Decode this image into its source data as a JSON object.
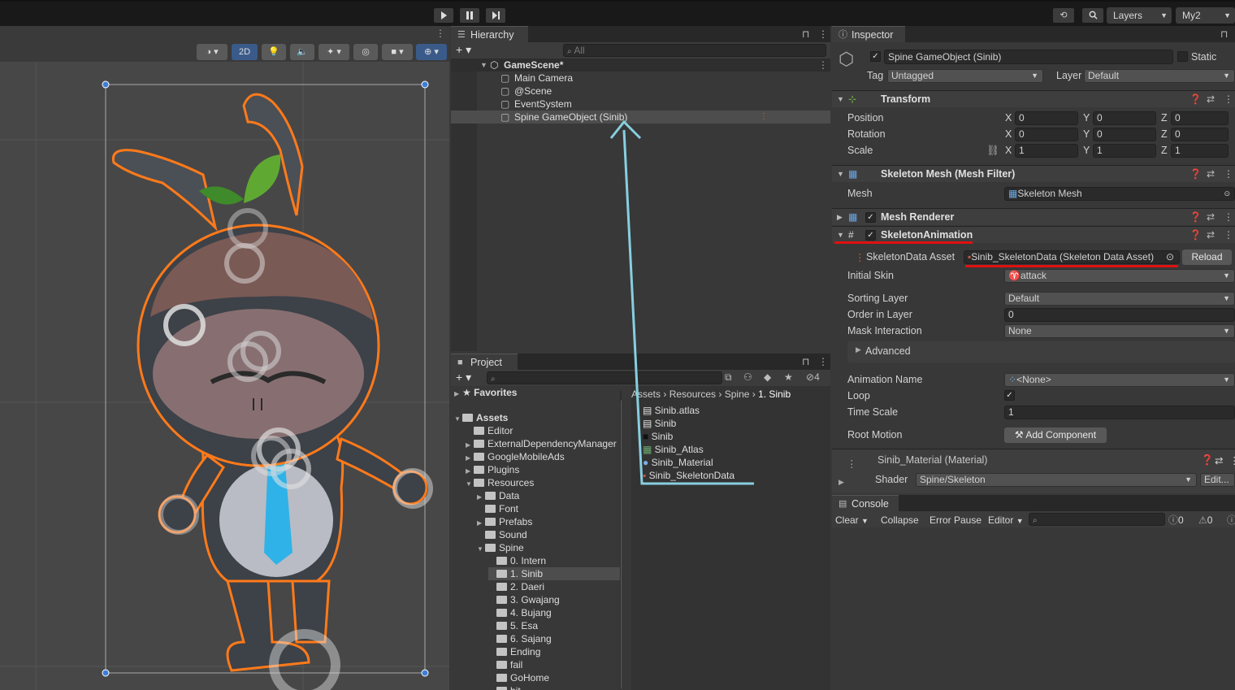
{
  "toolbar": {
    "play_icon": "play-icon",
    "pause_icon": "pause-icon",
    "step_icon": "step-icon",
    "layers_label": "Layers",
    "layout_label": "My2"
  },
  "scene": {
    "mode_2d": "2D"
  },
  "hierarchy": {
    "tab_label": "Hierarchy",
    "search_placeholder": "All",
    "scene_name": "GameScene*",
    "items": [
      {
        "label": "Main Camera"
      },
      {
        "label": "@Scene"
      },
      {
        "label": "EventSystem"
      },
      {
        "label": "Spine GameObject (Sinib)"
      }
    ]
  },
  "project": {
    "tab_label": "Project",
    "hidden_count": "4",
    "favorites_label": "Favorites",
    "assets_label": "Assets",
    "tree": [
      {
        "label": "Editor",
        "indent": 1,
        "arrow": false
      },
      {
        "label": "ExternalDependencyManager",
        "indent": 1,
        "arrow": true
      },
      {
        "label": "GoogleMobileAds",
        "indent": 1,
        "arrow": true
      },
      {
        "label": "Plugins",
        "indent": 1,
        "arrow": true
      },
      {
        "label": "Resources",
        "indent": 1,
        "arrow": true,
        "open": true
      },
      {
        "label": "Data",
        "indent": 2,
        "arrow": true
      },
      {
        "label": "Font",
        "indent": 2,
        "arrow": false
      },
      {
        "label": "Prefabs",
        "indent": 2,
        "arrow": true
      },
      {
        "label": "Sound",
        "indent": 2,
        "arrow": false
      },
      {
        "label": "Spine",
        "indent": 2,
        "arrow": true,
        "open": true
      },
      {
        "label": "0. Intern",
        "indent": 3,
        "arrow": false
      },
      {
        "label": "1. Sinib",
        "indent": 3,
        "arrow": false,
        "selected": true
      },
      {
        "label": "2. Daeri",
        "indent": 3,
        "arrow": false
      },
      {
        "label": "3. Gwajang",
        "indent": 3,
        "arrow": false
      },
      {
        "label": "4. Bujang",
        "indent": 3,
        "arrow": false
      },
      {
        "label": "5. Esa",
        "indent": 3,
        "arrow": false
      },
      {
        "label": "6. Sajang",
        "indent": 3,
        "arrow": false
      },
      {
        "label": "Ending",
        "indent": 3,
        "arrow": false
      },
      {
        "label": "fail",
        "indent": 3,
        "arrow": false
      },
      {
        "label": "GoHome",
        "indent": 3,
        "arrow": false
      },
      {
        "label": "hit",
        "indent": 3,
        "arrow": false
      }
    ],
    "breadcrumb": [
      "Assets",
      "Resources",
      "Spine",
      "1. Sinib"
    ],
    "files": [
      {
        "label": "Sinib.atlas",
        "icon": "text-file-icon"
      },
      {
        "label": "Sinib",
        "icon": "text-file-icon"
      },
      {
        "label": "Sinib",
        "icon": "texture-icon"
      },
      {
        "label": "Sinib_Atlas",
        "icon": "atlas-asset-icon"
      },
      {
        "label": "Sinib_Material",
        "icon": "material-icon"
      },
      {
        "label": "Sinib_SkeletonData",
        "icon": "skeleton-data-icon"
      }
    ]
  },
  "inspector": {
    "tab_label": "Inspector",
    "object_name": "Spine GameObject (Sinib)",
    "static_label": "Static",
    "tag_label": "Tag",
    "tag_value": "Untagged",
    "layer_label": "Layer",
    "layer_value": "Default",
    "transform": {
      "title": "Transform",
      "position_label": "Position",
      "rotation_label": "Rotation",
      "scale_label": "Scale",
      "position": {
        "x": "0",
        "y": "0",
        "z": "0"
      },
      "rotation": {
        "x": "0",
        "y": "0",
        "z": "0"
      },
      "scale": {
        "x": "1",
        "y": "1",
        "z": "1"
      }
    },
    "mesh_filter": {
      "title": "Skeleton Mesh (Mesh Filter)",
      "mesh_label": "Mesh",
      "mesh_value": "Skeleton Mesh"
    },
    "mesh_renderer": {
      "title": "Mesh Renderer"
    },
    "skeleton_animation": {
      "title": "SkeletonAnimation",
      "data_asset_label": "SkeletonData Asset",
      "data_asset_value": "Sinib_SkeletonData (Skeleton Data Asset)",
      "reload_label": "Reload",
      "initial_skin_label": "Initial Skin",
      "initial_skin_value": "attack",
      "sorting_layer_label": "Sorting Layer",
      "sorting_layer_value": "Default",
      "order_label": "Order in Layer",
      "order_value": "0",
      "mask_label": "Mask Interaction",
      "mask_value": "None",
      "advanced_label": "Advanced",
      "anim_name_label": "Animation Name",
      "anim_name_value": "<None>",
      "loop_label": "Loop",
      "time_scale_label": "Time Scale",
      "time_scale_value": "1",
      "root_motion_label": "Root Motion",
      "add_component_label": "Add Component"
    },
    "material": {
      "title": "Sinib_Material (Material)",
      "shader_label": "Shader",
      "shader_value": "Spine/Skeleton",
      "edit_label": "Edit..."
    }
  },
  "console": {
    "tab_label": "Console",
    "clear_label": "Clear",
    "collapse_label": "Collapse",
    "error_pause_label": "Error Pause",
    "editor_label": "Editor",
    "info_count": "0",
    "warn_count": "0"
  },
  "annotation": {
    "drag_arrow_color": "#87cfe0",
    "underline_color": "#e01010",
    "outline_color": "#ff7a1a"
  }
}
